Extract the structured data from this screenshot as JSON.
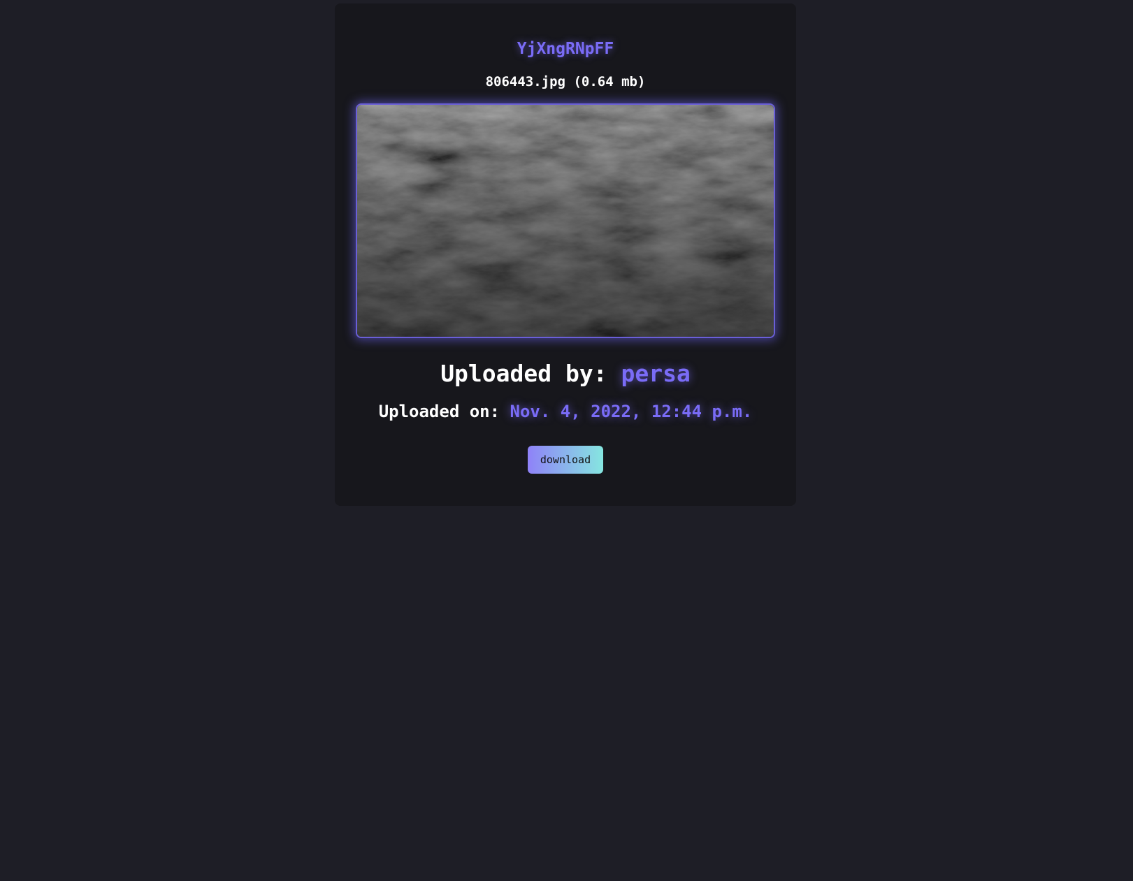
{
  "file": {
    "code": "YjXngRNpFF",
    "name_and_size": "806443.jpg (0.64 mb)"
  },
  "uploader": {
    "label": "Uploaded by: ",
    "name": "persa"
  },
  "upload_date": {
    "label": "Uploaded on: ",
    "value": "Nov. 4, 2022, 12:44 p.m."
  },
  "actions": {
    "download_label": "download"
  },
  "colors": {
    "background": "#1e1e26",
    "card": "#17171c",
    "accent": "#7a6cf7",
    "button_gradient_start": "#8f82f8",
    "button_gradient_end": "#86e6e0"
  }
}
